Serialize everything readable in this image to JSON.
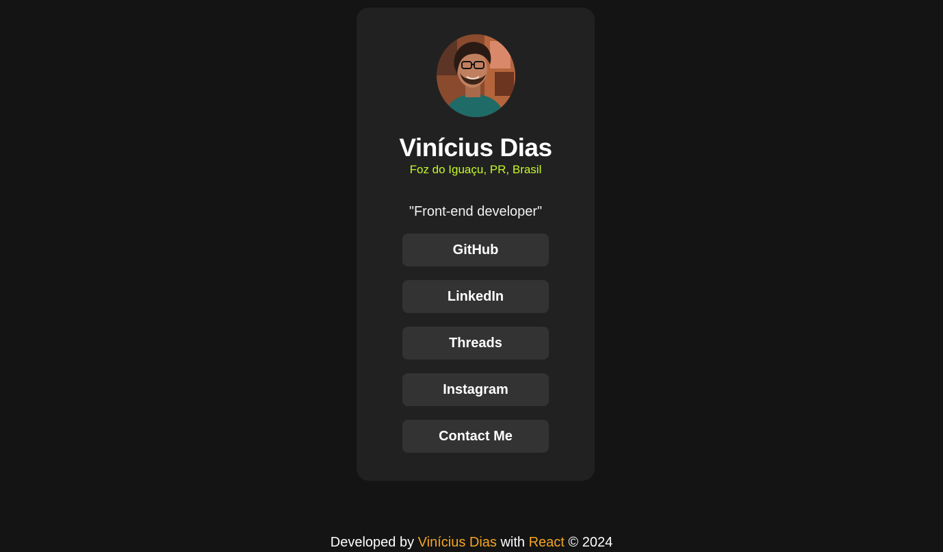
{
  "profile": {
    "name": "Vinícius Dias",
    "location": "Foz do Iguaçu, PR, Brasil",
    "bio": "\"Front-end developer\""
  },
  "links": [
    {
      "label": "GitHub"
    },
    {
      "label": "LinkedIn"
    },
    {
      "label": "Threads"
    },
    {
      "label": "Instagram"
    },
    {
      "label": "Contact Me"
    }
  ],
  "footer": {
    "prefix": "Developed by ",
    "author": "Vinícius Dias",
    "middle": " with ",
    "framework": "React",
    "suffix": " © 2024"
  },
  "colors": {
    "background": "#141414",
    "card": "#212121",
    "button": "#333333",
    "location_accent": "#c5f82a",
    "footer_accent": "#f5a623"
  }
}
